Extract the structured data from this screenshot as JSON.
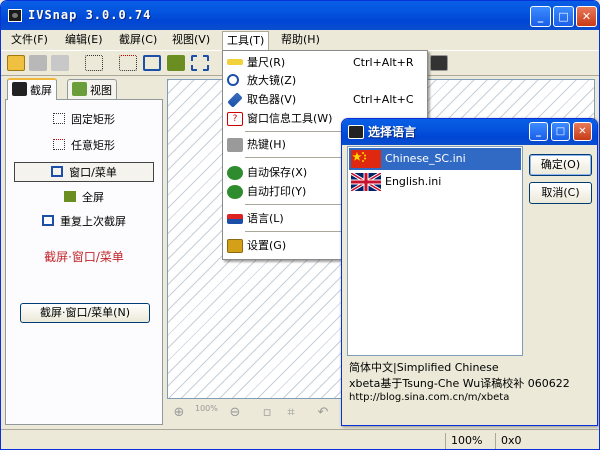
{
  "window": {
    "title": "IVSnap 3.0.0.74"
  },
  "menubar": [
    "文件(F)",
    "编辑(E)",
    "截屏(C)",
    "视图(V)",
    "工具(T)",
    "帮助(H)"
  ],
  "tabs": [
    {
      "label": "截屏"
    },
    {
      "label": "视图"
    }
  ],
  "capture_panel": {
    "items": [
      "固定矩形",
      "任意矩形",
      "窗口/菜单",
      "全屏",
      "重复上次截屏"
    ],
    "selected": "窗口/菜单",
    "current_mode": "截屏·窗口/菜单",
    "button": "截屏·窗口/菜单(N)"
  },
  "tools_menu": [
    {
      "label": "量尺(R)",
      "shortcut": "Ctrl+Alt+R",
      "icon": "ruler-icon"
    },
    {
      "label": "放大镜(Z)",
      "shortcut": "",
      "icon": "magnifier-icon"
    },
    {
      "label": "取色器(V)",
      "shortcut": "Ctrl+Alt+C",
      "icon": "eyedropper-icon"
    },
    {
      "label": "窗口信息工具(W)",
      "shortcut": "",
      "icon": "window-info-icon"
    },
    {
      "label": "热键(H)",
      "shortcut": "",
      "icon": "hotkey-icon"
    },
    {
      "label": "自动保存(X)",
      "shortcut": "",
      "icon": "autosave-icon"
    },
    {
      "label": "自动打印(Y)",
      "shortcut": "",
      "icon": "autoprint-icon"
    },
    {
      "label": "语言(L)",
      "shortcut": "",
      "icon": "language-icon"
    },
    {
      "label": "设置(G)",
      "shortcut": "",
      "icon": "settings-icon"
    }
  ],
  "language_dialog": {
    "title": "选择语言",
    "languages": [
      {
        "name": "Chinese_SC.ini",
        "flag": "china-flag-icon"
      },
      {
        "name": "English.ini",
        "flag": "uk-flag-icon"
      }
    ],
    "selected": "Chinese_SC.ini",
    "ok_label": "确定(O)",
    "cancel_label": "取消(C)",
    "info_line1": "简体中文|Simplified Chinese",
    "info_line2": "xbeta基于Tsung-Che Wu译稿校补 060622",
    "info_line3": "http://blog.sina.com.cn/m/xbeta"
  },
  "canvas_tools": {
    "zoom_percent": "100%"
  },
  "statusbar": {
    "zoom": "100%",
    "color": "0x0"
  }
}
